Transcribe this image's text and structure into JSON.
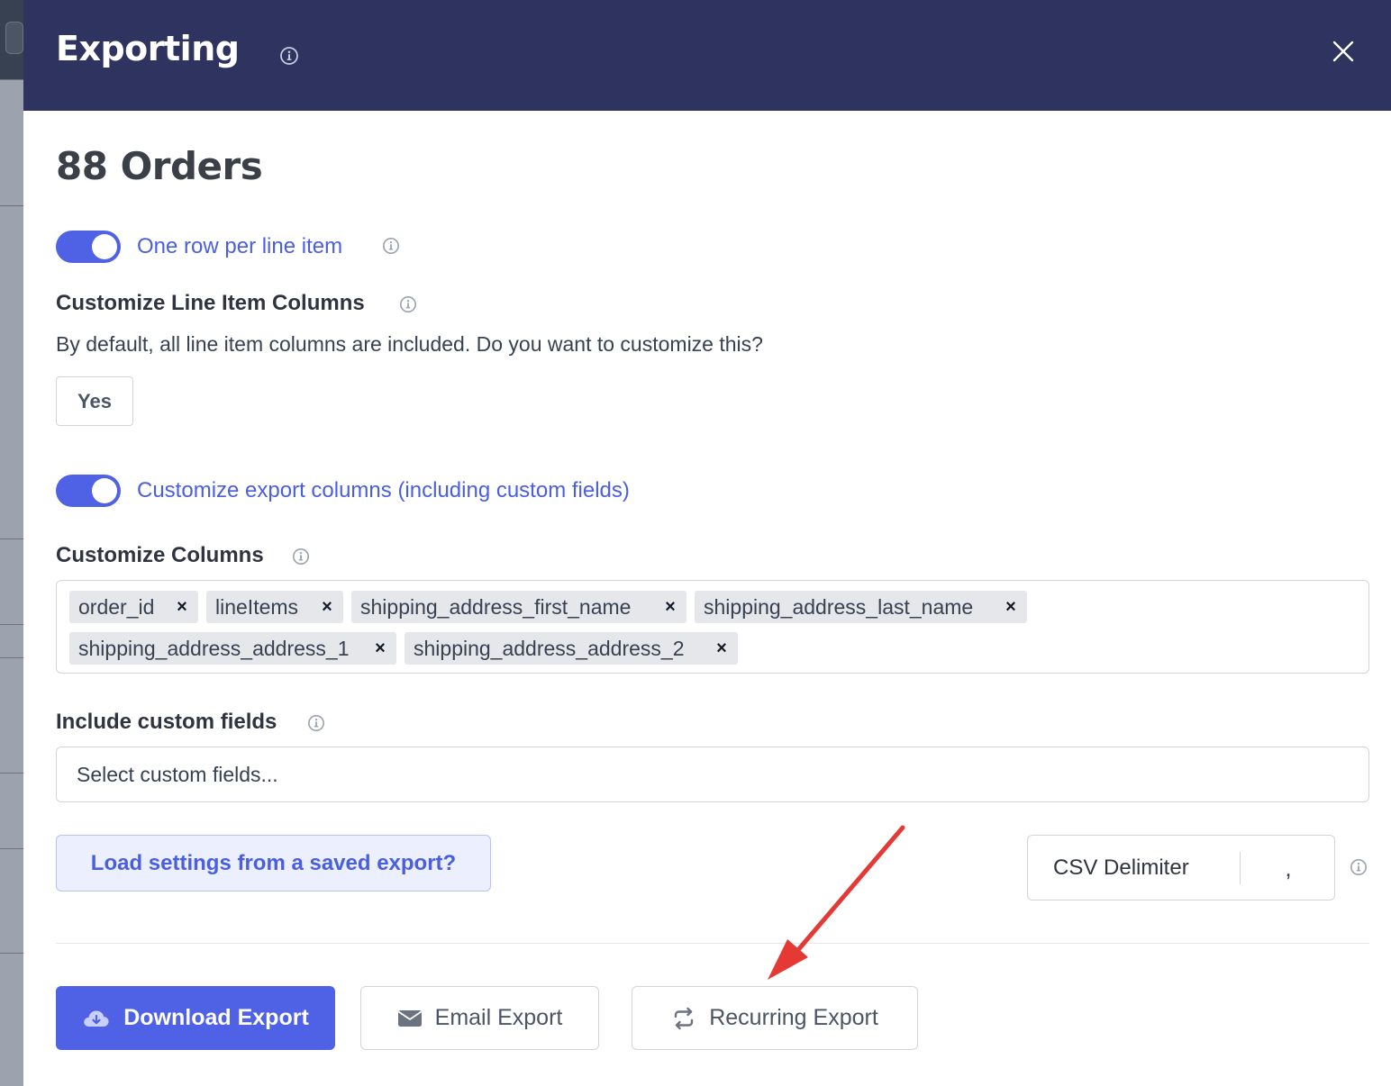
{
  "modal": {
    "title": "Exporting",
    "close_label": "×"
  },
  "summary": {
    "count_title": "88 Orders"
  },
  "line_item_toggle": {
    "label": "One row per line item",
    "checked": true
  },
  "customize_line_items": {
    "heading": "Customize Line Item Columns",
    "helper": "By default, all line item columns are included. Do you want to customize this?",
    "yes_label": "Yes"
  },
  "export_columns_toggle": {
    "label": "Customize export columns (including custom fields)",
    "checked": true
  },
  "customize_columns": {
    "heading": "Customize Columns",
    "tags": [
      "order_id",
      "lineItems",
      "shipping_address_first_name",
      "shipping_address_last_name",
      "shipping_address_address_1",
      "shipping_address_address_2"
    ],
    "remove_glyph": "×"
  },
  "custom_fields": {
    "heading": "Include custom fields",
    "placeholder": "Select custom fields..."
  },
  "saved_export": {
    "label": "Load settings from a saved export?"
  },
  "csv": {
    "label": "CSV Delimiter",
    "value": ","
  },
  "actions": {
    "download": "Download Export",
    "email": "Email Export",
    "recurring": "Recurring Export"
  },
  "colors": {
    "header_bg": "#2e335f",
    "accent": "#4f62e6",
    "annotation_arrow": "#e53935"
  },
  "icons": [
    "info-icon",
    "close-icon",
    "cloud-download-icon",
    "envelope-icon",
    "repeat-icon",
    "remove-tag-icon",
    "annotation-arrow"
  ]
}
